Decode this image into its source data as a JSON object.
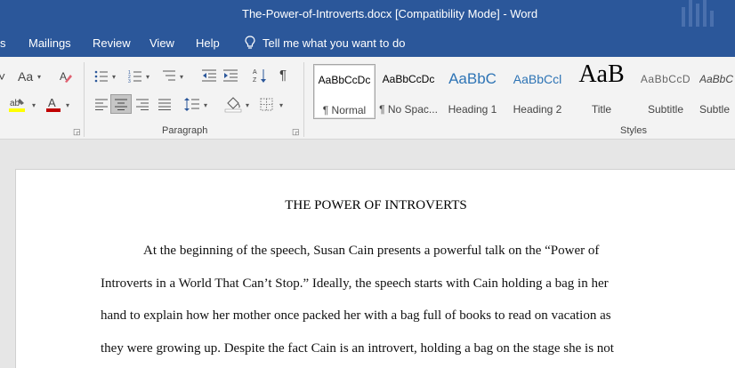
{
  "window": {
    "title": "The-Power-of-Introverts.docx [Compatibility Mode]  -  Word"
  },
  "tabs": [
    "s",
    "Mailings",
    "Review",
    "View",
    "Help"
  ],
  "tell_me": "Tell me what you want to do",
  "ribbon": {
    "paragraph_label": "Paragraph",
    "styles_label": "Styles",
    "font_size_glyph": "Aa",
    "styles": [
      {
        "sample": "AaBbCcDc",
        "name": "¶ Normal"
      },
      {
        "sample": "AaBbCcDc",
        "name": "¶ No Spac..."
      },
      {
        "sample": "AaBbC",
        "name": "Heading 1"
      },
      {
        "sample": "AaBbCcl",
        "name": "Heading 2"
      },
      {
        "sample": "AaB",
        "name": "Title"
      },
      {
        "sample": "AaBbCcD",
        "name": "Subtitle"
      },
      {
        "sample": "AaBbC",
        "name": "Subtle"
      }
    ]
  },
  "document": {
    "title": "THE POWER OF INTROVERTS",
    "lines": [
      "At the beginning of the speech, Susan Cain presents a powerful talk on the “Power of",
      "Introverts in a World That Can’t Stop.” Ideally, the speech starts with Cain holding a bag in her",
      "hand to explain how her mother once packed her with a bag full of books to read on vacation as",
      "they were growing up. Despite the fact Cain is an introvert, holding a bag on the stage she is not"
    ]
  },
  "colors": {
    "ribbon_blue": "#2b579a",
    "highlight_yellow": "#ffff00",
    "font_red": "#c00000"
  }
}
